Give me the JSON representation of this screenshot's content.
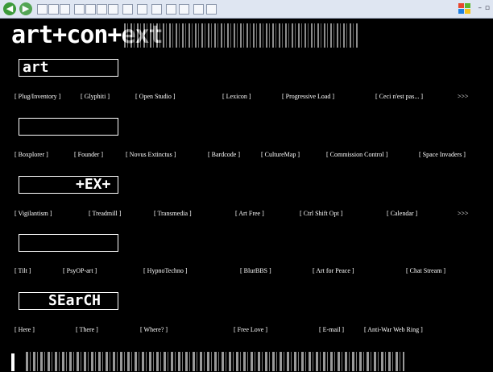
{
  "header": {
    "logo": "art+con+ext",
    "brand": "artcontext"
  },
  "sections": [
    {
      "title": "art",
      "links": [
        "[ Plug/Inventory ]",
        "[ Glyphiti ]",
        "[ Open Studio ]",
        "[ Lexicon ]",
        "[ Progressive Load ]",
        "[ Ceci n'est pas... ]",
        ">>>"
      ]
    },
    {
      "title": "",
      "links": [
        "[ Boxplorer ]",
        "[ Founder ]",
        "[ Novus Extinctus ]",
        "[ Bardcode ]",
        "[ CultureMap ]",
        "[ Commission Control ]",
        "[ Space Invaders ]"
      ]
    },
    {
      "title": "+EX+",
      "links": [
        "[ Vigilantism ]",
        "[ Treadmill ]",
        "[ Transmedia ]",
        "[ Art Free ]",
        "[ Ctrl Shift Opt ]",
        "[ Calendar ]",
        ">>>"
      ]
    },
    {
      "title": "",
      "links": [
        "[ Tilt ]",
        "[ PsyOP-art ]",
        "[ HypnoTechno ]",
        "[ BlurBBS ]",
        "[ Art for Peace ]",
        "[ Chat Stream ]"
      ]
    },
    {
      "title": "SEarCH",
      "links": [
        "[ Here ]",
        "[ There ]",
        "[ Where? ]",
        "[ Free Love ]",
        "[ E-mail ]",
        "[ Anti-War Web Ring ]"
      ]
    }
  ],
  "colors": {
    "background": "#000000",
    "text": "#ffffff",
    "toolbar": "#dfe6f2"
  }
}
